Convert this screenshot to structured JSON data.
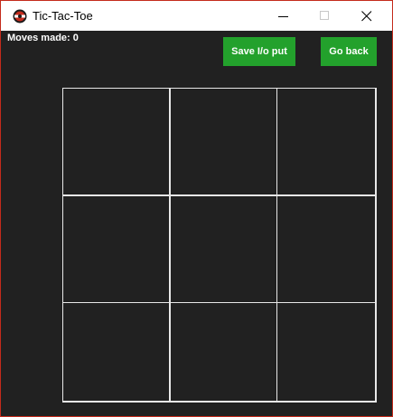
{
  "window": {
    "title": "Tic-Tac-Toe",
    "icon": "tic-tac-toe-app-icon"
  },
  "status": {
    "moves_label": "Moves made: 0"
  },
  "buttons": {
    "save_label": "Save I/o put",
    "back_label": "Go back"
  },
  "colors": {
    "background": "#212121",
    "button": "#23a12c",
    "grid_lines": "#e8e8e8",
    "window_border": "#c42b1c"
  },
  "board": {
    "cells": [
      "",
      "",
      "",
      "",
      "",
      "",
      "",
      "",
      ""
    ]
  }
}
